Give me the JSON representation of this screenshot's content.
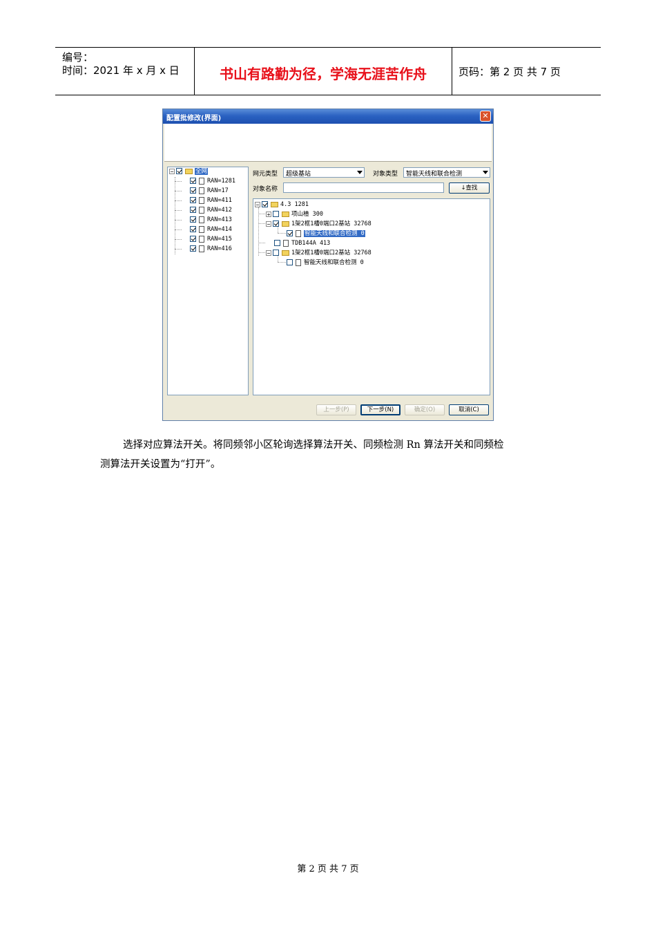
{
  "header": {
    "serial_label": "编号：",
    "date_label": "时间：2021 年 x 月 x 日",
    "motto": "书山有路勤为径，学海无涯苦作舟",
    "page_info": "页码：第 2 页  共 7 页"
  },
  "dialog": {
    "title": "配置批修改(界面)",
    "close_glyph": "✕",
    "left_tree": {
      "root": {
        "label": "全网",
        "checked": true
      },
      "items": [
        {
          "label": "RAN=1281",
          "checked": true
        },
        {
          "label": "RAN=17",
          "checked": true
        },
        {
          "label": "RAN=411",
          "checked": true
        },
        {
          "label": "RAN=412",
          "checked": true
        },
        {
          "label": "RAN=413",
          "checked": true
        },
        {
          "label": "RAN=414",
          "checked": true
        },
        {
          "label": "RAN=415",
          "checked": true
        },
        {
          "label": "RAN=416",
          "checked": true
        }
      ]
    },
    "ne_type_label": "网元类型",
    "ne_type_value": "超级基站",
    "obj_type_label": "对象类型",
    "obj_type_value": "智能天线和联合检测",
    "obj_name_label": "对象名称",
    "obj_name_value": "",
    "search_button": "↓查找",
    "right_tree": [
      {
        "label": "4.3 1281",
        "checked": true
      },
      {
        "label": "项山楂 300",
        "checked": false
      },
      {
        "label": "1架2框1槽0端口2基站 32768",
        "checked": true
      },
      {
        "label": "智能天线和联合检测 0",
        "checked": true
      },
      {
        "label": "TDB144A 413",
        "checked": false
      },
      {
        "label": "1架2框1槽0端口2基站 32768",
        "checked": false
      },
      {
        "label": "智能天线和联合检测 0",
        "checked": false
      }
    ],
    "buttons": {
      "prev": "上一步(P)",
      "next": "下一步(N)",
      "ok": "确定(O)",
      "cancel": "取消(C)"
    }
  },
  "body": {
    "line1": "选择对应算法开关。将同频邻小区轮询选择算法开关、同频检测 Rn 算法开关和同频检",
    "line2": "测算法开关设置为“打开”。"
  },
  "footer": "第 2 页 共 7 页"
}
